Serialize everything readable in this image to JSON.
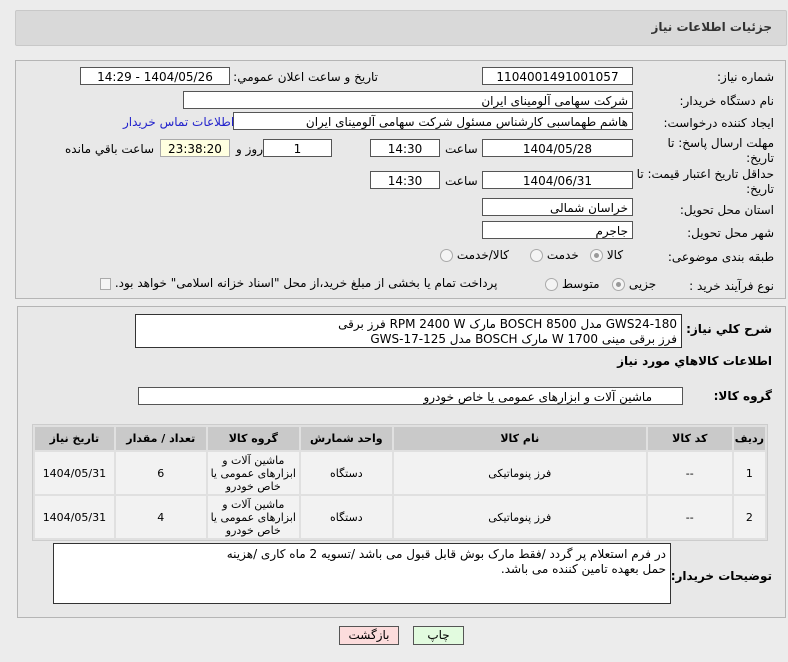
{
  "header": {
    "title": "جزئیات اطلاعات نیاز"
  },
  "form": {
    "need_number_label": "شماره نیاز:",
    "need_number": "1104001491001057",
    "announce_label": "تاریخ و ساعت اعلان عمومي:",
    "announce_value": "1404/05/26 - 14:29",
    "buyer_label": "نام دستگاه خریدار:",
    "buyer_value": "شرکت سهامی آلومینای ایران",
    "creator_label": "ایجاد کننده درخواست:",
    "creator_value": "هاشم طهماسبی کارشناس مسئول شرکت سهامی آلومینای ایران",
    "contact_link": "اطلاعات تماس خریدار",
    "deadline_label": "مهلت ارسال پاسخ: تا تاریخ:",
    "deadline_date": "1404/05/28",
    "time_label": "ساعت",
    "deadline_time": "14:30",
    "days": "1",
    "days_label": "روز و",
    "remaining": "23:38:20",
    "remaining_label": "ساعت باقي مانده",
    "validity_label": "حداقل تاریخ اعتبار قیمت: تا تاریخ:",
    "validity_date": "1404/06/31",
    "validity_time": "14:30",
    "province_label": "استان محل تحویل:",
    "province": "خراسان شمالی",
    "city_label": "شهر محل تحویل:",
    "city": "جاجرم",
    "category_label": "طبقه بندی موضوعی:",
    "category_options": [
      "کالا",
      "خدمت",
      "کالا/خدمت"
    ],
    "process_label": "نوع فرآیند خرید :",
    "process_options": [
      "جزیی",
      "متوسط"
    ],
    "payment_note": "پرداخت تمام یا بخشی از مبلغ خرید،از محل \"اسناد خزانه اسلامی\" خواهد بود."
  },
  "details": {
    "desc_label": "شرح کلي نیاز:",
    "desc_line1": "GWS24-180 مدل BOSCH 8500 مارک RPM 2400 W فرز برقی",
    "desc_line2": "فرز برقی مینی W 1700 مارک BOSCH مدل GWS-17-125",
    "goods_heading": "اطلاعات کالاهاي مورد نیاز",
    "group_label": "گروه کالا:",
    "group_value": "ماشین آلات و ابزارهای عمومی یا خاص خودرو",
    "columns": [
      "ردیف",
      "کد کالا",
      "نام کالا",
      "واحد شمارش",
      "گروه کالا",
      "تعداد / مقدار",
      "تاریخ نیاز"
    ],
    "rows": [
      [
        "1",
        "--",
        "فرز پنوماتیکی",
        "دستگاه",
        "ماشین آلات و ابزارهای عمومی یا خاص خودرو",
        "6",
        "1404/05/31"
      ],
      [
        "2",
        "--",
        "فرز پنوماتیکی",
        "دستگاه",
        "ماشین آلات و ابزارهای عمومی یا خاص خودرو",
        "4",
        "1404/05/31"
      ]
    ],
    "notes_label": "توضیحات خریدار:",
    "notes": "در فرم استعلام پر گردد /فقط مارک بوش قابل قبول می باشد /تسویه 2 ماه کاری /هزینه حمل بعهده تامین کننده می باشد."
  },
  "buttons": {
    "print": "چاپ",
    "back": "بازگشت"
  }
}
